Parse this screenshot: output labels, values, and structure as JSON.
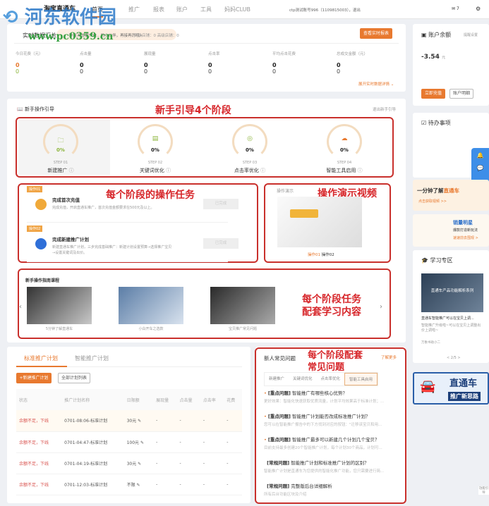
{
  "watermark": {
    "name": "河东软件园",
    "url": "www.pc0359.cn"
  },
  "nav": {
    "logo": "淘宝直通车",
    "items": [
      "首页",
      "推广",
      "报表",
      "账户",
      "工具",
      "妈妈CLUB"
    ],
    "user": "ctp测试账号996（1109815003），退出",
    "mail_count": "7"
  },
  "realtime": {
    "title": "实时数据汇总",
    "notice": "昨日点击量TOP... 的小伙伴，再接再厉哦~",
    "shops": "同级店铺：0  高级店铺：0",
    "report_btn": "查看实时报表",
    "expand": "展开实时数据详情",
    "metrics": [
      {
        "label": "今日花费（元）",
        "v1": "0",
        "v2": "0"
      },
      {
        "label": "点击量",
        "v1": "0",
        "v2": "0"
      },
      {
        "label": "展现量",
        "v1": "0",
        "v2": "0"
      },
      {
        "label": "点击率",
        "v1": "0",
        "v2": "0"
      },
      {
        "label": "平均点击花费",
        "v1": "0",
        "v2": "0"
      },
      {
        "label": "总成交金额（元）",
        "v1": "0",
        "v2": "0"
      }
    ]
  },
  "guide": {
    "title": "新手操作引导",
    "exit": "退出新手引导",
    "annotation": "新手引导4个阶段",
    "steps": [
      {
        "icon": "🗀",
        "pct": "0%",
        "step": "STEP 01",
        "name": "新建推广"
      },
      {
        "icon": "▤",
        "pct": "0%",
        "step": "STEP 02",
        "name": "关键词优化"
      },
      {
        "icon": "◎",
        "pct": "0%",
        "step": "STEP 03",
        "name": "点击率优化"
      },
      {
        "icon": "☁",
        "pct": "0%",
        "step": "STEP 04",
        "name": "智能工具启用"
      }
    ],
    "tasks_annotation": "每个阶段的操作任务",
    "tasks": [
      {
        "tag": "操作01",
        "title": "完成首次充值",
        "desc": "完成充值，开启直通车推广，首次充值金额要求在500元及以上。",
        "btn": "已完成"
      },
      {
        "tag": "操作02",
        "title": "完成新建推广计划",
        "desc": "新建直通车推广计划，三步完成基础推广：新建计划设置预算→选择推广宝贝→设置关键词及出价。",
        "btn": "已完成"
      }
    ],
    "video": {
      "title": "操作演示",
      "annotation": "操作演示视频",
      "tabs": [
        "操作01",
        "操作02"
      ]
    },
    "courses": {
      "title": "新手操作指南课程",
      "annotation": "每个阶段任务\n配套学习内容",
      "items": [
        "5分钟了解直通车",
        "小白开车之选款",
        "宝贝推广常见问题"
      ]
    }
  },
  "plans": {
    "tabs": [
      "标准推广计划",
      "智能推广计划"
    ],
    "new_btn": "+新建推广计划",
    "all_btn": "全部计划列表",
    "headers": [
      "状态",
      "推广计划名称",
      "日限额",
      "展现量",
      "点击量",
      "点击率",
      "花费"
    ],
    "rows": [
      [
        "余额不足，下线",
        "0701-08:06-标准计划",
        "30元",
        "-",
        "-",
        "-",
        "-"
      ],
      [
        "余额不足，下线",
        "0701-04:47-标准计划",
        "100元",
        "-",
        "-",
        "-",
        "-"
      ],
      [
        "余额不足，下线",
        "0701-04:19-标准计划",
        "30元",
        "-",
        "-",
        "-",
        "-"
      ],
      [
        "余额不足，下线",
        "0701-12:03-标准计划",
        "不限",
        "-",
        "-",
        "-",
        "-"
      ]
    ]
  },
  "faq": {
    "title": "新人常见问题",
    "more": "了解更多",
    "annotation": "每个阶段配套\n常见问题",
    "tabs": [
      "新建推广",
      "关键词优化",
      "点击率优化",
      "智能工具启用"
    ],
    "items": [
      {
        "tag": "[重点问题]",
        "q": "智能推广有哪些核心优势？",
        "a": "更好效果：智能化快速获取优质流量，计划平均效果高于标准计划；..."
      },
      {
        "tag": "[重点问题]",
        "q": "智能推广计划能否改成标准推广计划？",
        "a": "您可以在智能推广报告中的下方找到对应的按钮：\"迁移该宝贝和用..."
      },
      {
        "tag": "[重点问题]",
        "q": "智能推广最多可以新建几个计划几个宝贝？",
        "a": "目前支持最多创建20个智能推广计划，每个计划30个商品，计划可..."
      },
      {
        "tag": "[常规问题]",
        "q": "智能推广计划和标准推广计划的区别？",
        "a": "智能推广计划是直通车为您提供的智能化推广功能，您只需要进行简..."
      },
      {
        "tag": "[常规问题]",
        "q": "完整版后台详细解析",
        "a": "所有后台功能区块及介绍"
      }
    ]
  },
  "account": {
    "title": "账户余额",
    "setting": "提醒设置",
    "balance": "-3.54",
    "unit": "元",
    "recharge": "立即充值",
    "detail": "账户明细"
  },
  "todo": {
    "title": "待办事项"
  },
  "banner1": {
    "text": "一分钟了解",
    "brand": "直通车",
    "sub": "点击获取视频 >>"
  },
  "banner2": {
    "title": "销量明星",
    "sub": "爆款打造新玩法",
    "link": "速速前去围观 >"
  },
  "learn": {
    "title": "学习专区",
    "img": "直通车产品功能解析系列",
    "t1": "直通车智能推广可以在宝贝上调...",
    "t2": "智能推广升级啦~可以在宝贝上调整出价上调啦~",
    "author": "万象书助小二",
    "pager": "< 2/5 >"
  },
  "car_banner": {
    "title": "直通车",
    "sub": "推广新思路"
  },
  "side_tool": "功能引导",
  "colors": {
    "accent": "#e8792f",
    "annotation": "#d7262a"
  }
}
